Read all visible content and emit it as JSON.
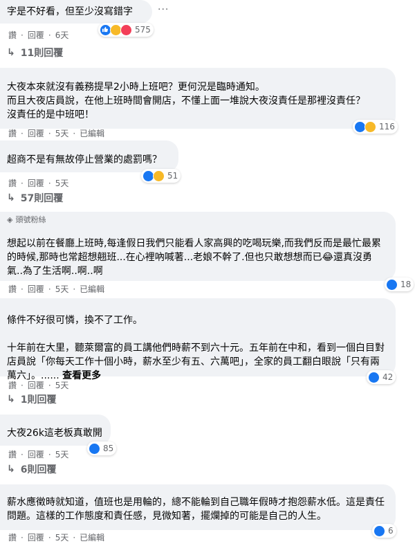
{
  "common": {
    "like": "讚",
    "reply": "回覆",
    "edited": "已編輯",
    "more_options": "···"
  },
  "comments": [
    {
      "text": "字是不好看，但至少沒寫錯字",
      "time": "6天",
      "reaction_count": "575",
      "reactions": [
        "like",
        "haha",
        "love"
      ],
      "replies": "11則回覆"
    },
    {
      "name": " ",
      "text": "大夜本來就沒有義務提早2小時上班吧？更何況是臨時通知。\n而且大夜店員說，在他上班時間會開店，不懂上面一堆說大夜沒責任是那裡沒責任？\n沒責任的是中班吧！",
      "time": "5天",
      "edited": true,
      "reaction_count": "116",
      "reactions": [
        "like",
        "haha"
      ]
    },
    {
      "name": " ",
      "text": "超商不是有無故停止營業的處罰嗎？",
      "time": "5天",
      "reaction_count": "51",
      "reactions": [
        "like",
        "sad"
      ],
      "replies": "57則回覆"
    },
    {
      "badge": "頭號粉絲",
      "text": "想起以前在餐廳上班時,每逢假日我們只能看人家高興的吃喝玩樂,而我們反而是最忙最累的時候,那時也常超想翹班...在心裡吶喊著...老娘不幹了.但也只敢想想而已😂還真沒勇氣..為了生活啊..啊..啊",
      "time": "5天",
      "edited": true,
      "reaction_count": "18",
      "reactions": [
        "like"
      ]
    },
    {
      "name": " ",
      "text": "條件不好很可憐，換不了工作。\n\n十年前在大里，聽萊爾富的員工講他們時薪不到六十元。五年前在中和，看到一個白目對店員說「你每天工作十個小時，薪水至少有五、六萬吧」，全家的員工翻白眼說「只有兩萬六」。......",
      "see_more": "查看更多",
      "time": "5天",
      "reaction_count": "42",
      "reactions": [
        "like"
      ],
      "replies": "1則回覆"
    },
    {
      "name": " ",
      "text": "大夜26k這老板真敢開",
      "time": "5天",
      "reaction_count": "85",
      "reactions": [
        "like"
      ],
      "replies": "6則回覆"
    },
    {
      "name": " ",
      "text": "薪水應徵時就知道，值班也是用輪的，總不能輪到自己職年假時才抱怨薪水低。這是責任問題。這樣的工作態度和責任感，見微知著，擺爛掉的可能是自己的人生。",
      "time": "5天",
      "edited": true,
      "reaction_count": "6",
      "reactions": [
        "like"
      ]
    }
  ]
}
